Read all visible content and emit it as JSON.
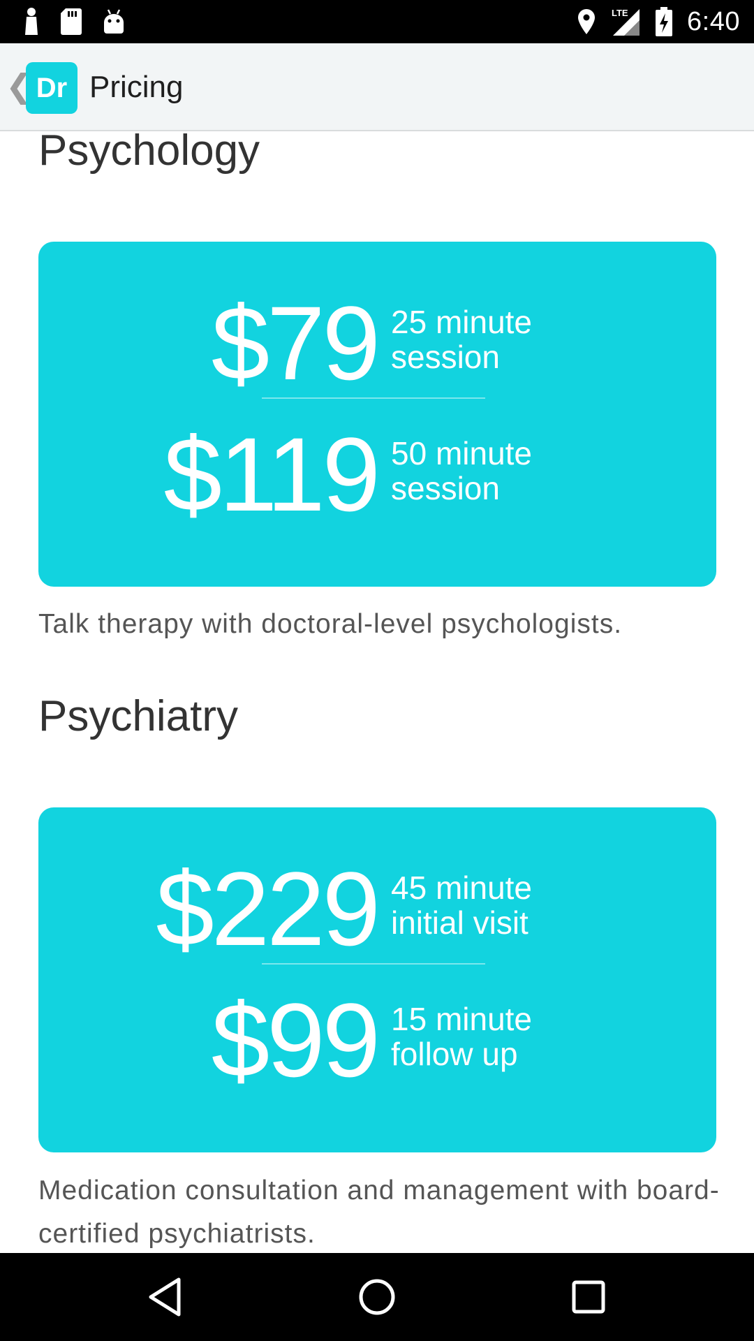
{
  "status_bar": {
    "time": "6:40",
    "network": "LTE",
    "left_icons": [
      "person-icon",
      "sd-card-icon",
      "android-icon"
    ],
    "right_icons": [
      "location-icon",
      "signal-icon",
      "battery-charging-icon"
    ]
  },
  "app_bar": {
    "logo_text": "Dr",
    "title": "Pricing"
  },
  "sections": [
    {
      "title": "Psychology",
      "prices": [
        {
          "amount": "$79",
          "duration": "25 minute",
          "type": "session"
        },
        {
          "amount": "$119",
          "duration": "50 minute",
          "type": "session"
        }
      ],
      "description": "Talk therapy with doctoral-level psychologists."
    },
    {
      "title": "Psychiatry",
      "prices": [
        {
          "amount": "$229",
          "duration": "45 minute",
          "type": "initial visit"
        },
        {
          "amount": "$99",
          "duration": "15 minute",
          "type": "follow up"
        }
      ],
      "description": "Medication consultation and management with board-certified psychiatrists."
    }
  ],
  "nav_bar": {
    "buttons": [
      "back-icon",
      "home-icon",
      "recents-icon"
    ]
  },
  "colors": {
    "accent": "#12d3df",
    "app_bar_bg": "#f2f5f6",
    "text_dark": "#333333",
    "text_muted": "#555555"
  }
}
